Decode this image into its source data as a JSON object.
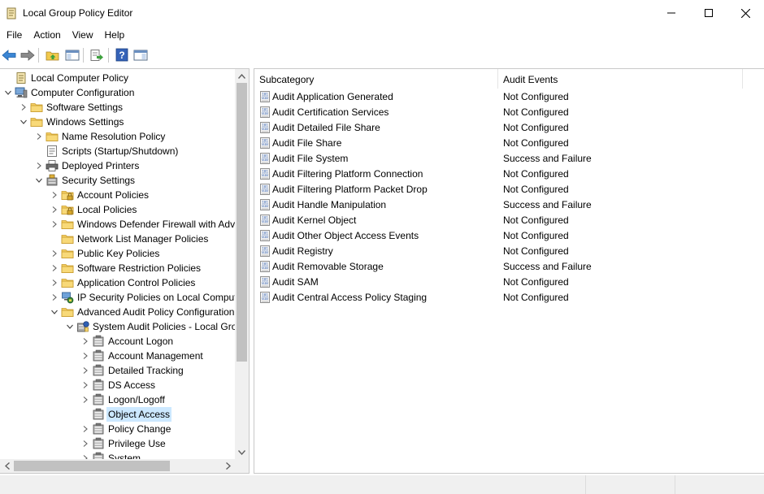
{
  "window": {
    "title": "Local Group Policy Editor",
    "icons": {
      "app": "policy-scroll-icon",
      "minimize": "minimize-icon",
      "maximize": "maximize-icon",
      "close": "close-icon"
    }
  },
  "menu": {
    "items": [
      {
        "label": "File"
      },
      {
        "label": "Action"
      },
      {
        "label": "View"
      },
      {
        "label": "Help"
      }
    ]
  },
  "toolbar": {
    "buttons": [
      {
        "icon": "back-arrow-icon"
      },
      {
        "icon": "forward-arrow-icon"
      },
      {
        "icon": "up-folder-icon"
      },
      {
        "icon": "show-hide-console-tree-icon"
      },
      {
        "icon": "export-list-icon"
      },
      {
        "icon": "help-icon"
      },
      {
        "icon": "show-action-pane-icon"
      }
    ]
  },
  "tree": {
    "items": [
      {
        "label": "Local Computer Policy",
        "level": 0,
        "expander": "none",
        "icon": "policy-scroll-icon"
      },
      {
        "label": "Computer Configuration",
        "level": 0,
        "expander": "expanded",
        "icon": "computer-icon"
      },
      {
        "label": "Software Settings",
        "level": 1,
        "expander": "collapsed",
        "icon": "folder-icon"
      },
      {
        "label": "Windows Settings",
        "level": 1,
        "expander": "expanded",
        "icon": "folder-icon"
      },
      {
        "label": "Name Resolution Policy",
        "level": 2,
        "expander": "collapsed",
        "icon": "folder-icon"
      },
      {
        "label": "Scripts (Startup/Shutdown)",
        "level": 2,
        "expander": "none",
        "icon": "script-icon"
      },
      {
        "label": "Deployed Printers",
        "level": 2,
        "expander": "collapsed",
        "icon": "printer-icon"
      },
      {
        "label": "Security Settings",
        "level": 2,
        "expander": "expanded",
        "icon": "security-settings-icon"
      },
      {
        "label": "Account Policies",
        "level": 3,
        "expander": "collapsed",
        "icon": "locked-folder-icon"
      },
      {
        "label": "Local Policies",
        "level": 3,
        "expander": "collapsed",
        "icon": "locked-folder-icon"
      },
      {
        "label": "Windows Defender Firewall with Advanced Security",
        "level": 3,
        "expander": "collapsed",
        "icon": "folder-icon"
      },
      {
        "label": "Network List Manager Policies",
        "level": 3,
        "expander": "none",
        "icon": "folder-icon"
      },
      {
        "label": "Public Key Policies",
        "level": 3,
        "expander": "collapsed",
        "icon": "folder-icon"
      },
      {
        "label": "Software Restriction Policies",
        "level": 3,
        "expander": "collapsed",
        "icon": "folder-icon"
      },
      {
        "label": "Application Control Policies",
        "level": 3,
        "expander": "collapsed",
        "icon": "folder-icon"
      },
      {
        "label": "IP Security Policies on Local Computer",
        "level": 3,
        "expander": "collapsed",
        "icon": "ip-security-icon"
      },
      {
        "label": "Advanced Audit Policy Configuration",
        "level": 3,
        "expander": "expanded",
        "icon": "folder-icon"
      },
      {
        "label": "System Audit Policies - Local Group Policy Object",
        "level": 4,
        "expander": "expanded",
        "icon": "audit-policy-icon"
      },
      {
        "label": "Account Logon",
        "level": 5,
        "expander": "collapsed",
        "icon": "audit-category-icon"
      },
      {
        "label": "Account Management",
        "level": 5,
        "expander": "collapsed",
        "icon": "audit-category-icon"
      },
      {
        "label": "Detailed Tracking",
        "level": 5,
        "expander": "collapsed",
        "icon": "audit-category-icon"
      },
      {
        "label": "DS Access",
        "level": 5,
        "expander": "collapsed",
        "icon": "audit-category-icon"
      },
      {
        "label": "Logon/Logoff",
        "level": 5,
        "expander": "collapsed",
        "icon": "audit-category-icon"
      },
      {
        "label": "Object Access",
        "level": 5,
        "expander": "none",
        "icon": "audit-category-icon",
        "selected": true
      },
      {
        "label": "Policy Change",
        "level": 5,
        "expander": "collapsed",
        "icon": "audit-category-icon"
      },
      {
        "label": "Privilege Use",
        "level": 5,
        "expander": "collapsed",
        "icon": "audit-category-icon"
      },
      {
        "label": "System",
        "level": 5,
        "expander": "collapsed",
        "icon": "audit-category-icon"
      }
    ]
  },
  "list": {
    "columns": [
      {
        "label": "Subcategory"
      },
      {
        "label": "Audit Events"
      }
    ],
    "rows": [
      {
        "name": "Audit Application Generated",
        "events": "Not Configured"
      },
      {
        "name": "Audit Certification Services",
        "events": "Not Configured"
      },
      {
        "name": "Audit Detailed File Share",
        "events": "Not Configured"
      },
      {
        "name": "Audit File Share",
        "events": "Not Configured"
      },
      {
        "name": "Audit File System",
        "events": "Success and Failure"
      },
      {
        "name": "Audit Filtering Platform Connection",
        "events": "Not Configured"
      },
      {
        "name": "Audit Filtering Platform Packet Drop",
        "events": "Not Configured"
      },
      {
        "name": "Audit Handle Manipulation",
        "events": "Success and Failure"
      },
      {
        "name": "Audit Kernel Object",
        "events": "Not Configured"
      },
      {
        "name": "Audit Other Object Access Events",
        "events": "Not Configured"
      },
      {
        "name": "Audit Registry",
        "events": "Not Configured"
      },
      {
        "name": "Audit Removable Storage",
        "events": "Success and Failure"
      },
      {
        "name": "Audit SAM",
        "events": "Not Configured"
      },
      {
        "name": "Audit Central Access Policy Staging",
        "events": "Not Configured"
      }
    ],
    "row_icon": "binary-policy-icon"
  },
  "colors": {
    "selection": "#cce8ff",
    "border": "#c8c8c8",
    "statusbar": "#f0f0f0",
    "scroll_thumb": "#c1c1c1"
  }
}
